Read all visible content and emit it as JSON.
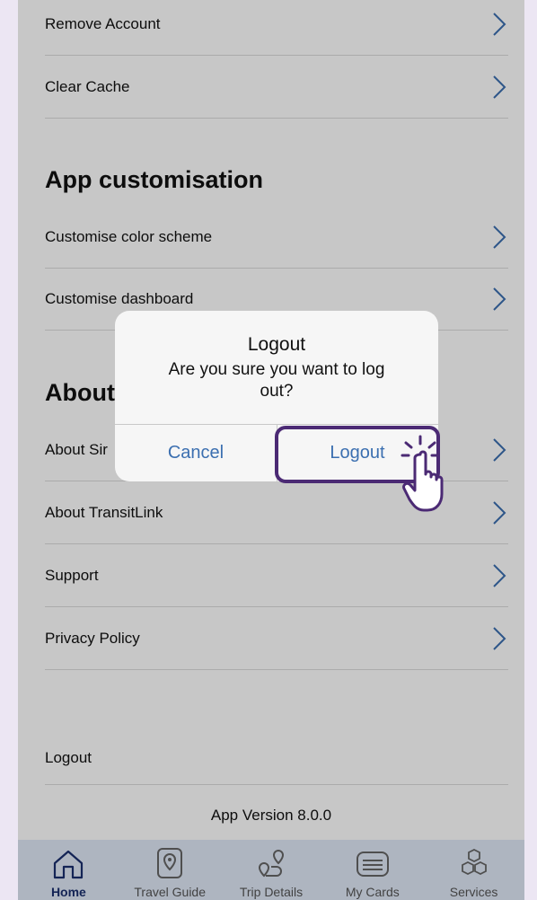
{
  "settings": {
    "rows_top": [
      {
        "label": "Remove Account"
      },
      {
        "label": "Clear Cache"
      }
    ],
    "section_app": "App customisation",
    "rows_app": [
      {
        "label": "Customise color scheme"
      },
      {
        "label": "Customise dashboard"
      }
    ],
    "section_about": "About",
    "rows_about": [
      {
        "label": "About Sir"
      },
      {
        "label": "About TransitLink"
      },
      {
        "label": "Support"
      },
      {
        "label": "Privacy Policy"
      }
    ],
    "logout_label": "Logout",
    "version": "App Version 8.0.0"
  },
  "dialog": {
    "title": "Logout",
    "message": "Are you sure you want to log out?",
    "cancel_label": "Cancel",
    "confirm_label": "Logout"
  },
  "tabbar": {
    "items": [
      {
        "label": "Home",
        "icon": "home-icon",
        "active": true
      },
      {
        "label": "Travel Guide",
        "icon": "location-pin-icon"
      },
      {
        "label": "Trip Details",
        "icon": "route-icon"
      },
      {
        "label": "My Cards",
        "icon": "card-icon"
      },
      {
        "label": "Services",
        "icon": "cubes-icon"
      }
    ]
  },
  "colors": {
    "accent_blue": "#3b6fb0",
    "highlight_purple": "#4b2a74",
    "tabbar_bg": "#dfe8f7",
    "page_bg": "#ece6f3"
  }
}
